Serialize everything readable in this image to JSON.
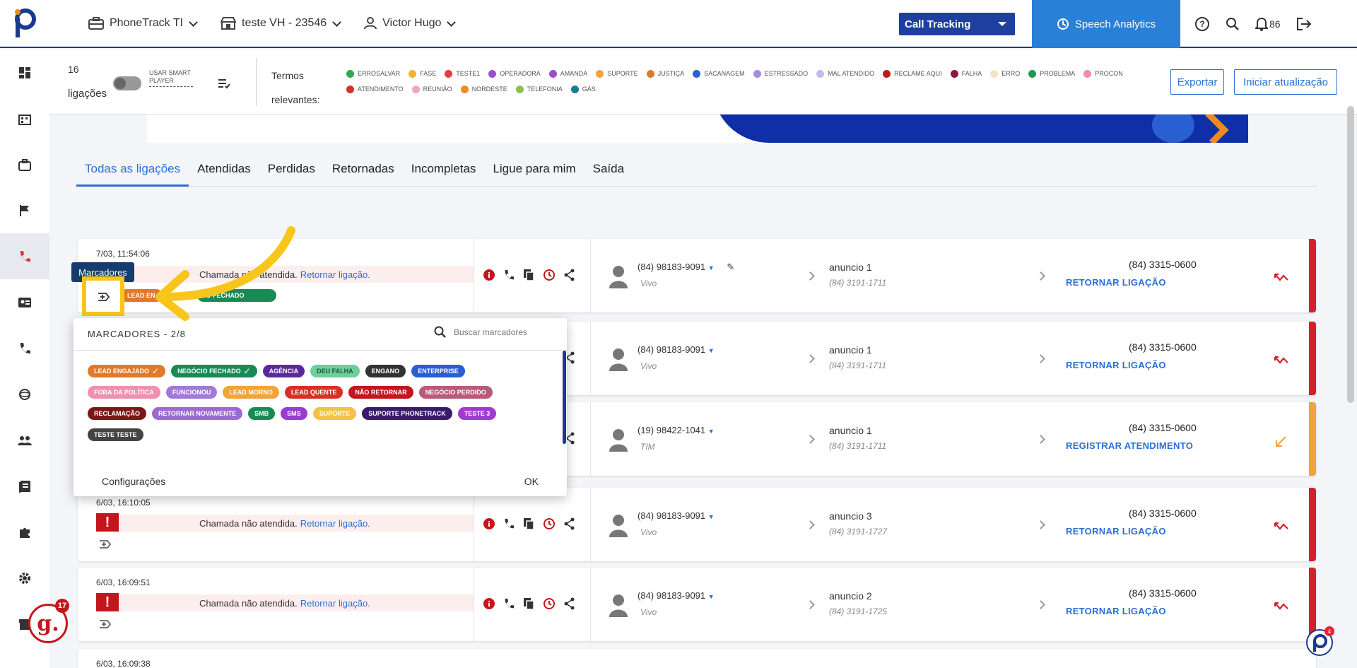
{
  "header": {
    "account": "PhoneTrack TI",
    "store": "teste VH - 23546",
    "user": "Victor Hugo",
    "product_select": "Call Tracking",
    "speech_label": "Speech Analytics",
    "notifications": "86"
  },
  "filters": {
    "count": "16",
    "count_label": "ligações",
    "smart_player": "USAR SMART PLAYER",
    "terms_label": "Termos relevantes:",
    "terms": [
      {
        "label": "ERROSALVAR",
        "color": "#2eaa55"
      },
      {
        "label": "FASE",
        "color": "#f2b233"
      },
      {
        "label": "TESTE1",
        "color": "#e04040"
      },
      {
        "label": "OPERADORA",
        "color": "#9a4fd1"
      },
      {
        "label": "AMANDA",
        "color": "#9a4fd1"
      },
      {
        "label": "SUPORTE",
        "color": "#f2a33a"
      },
      {
        "label": "JUSTIÇA",
        "color": "#e07a2a"
      },
      {
        "label": "SACANAGEM",
        "color": "#2a5fd1"
      },
      {
        "label": "ESTRESSADO",
        "color": "#a68be0"
      },
      {
        "label": "MAL ATENDIDO",
        "color": "#c9b8ee"
      },
      {
        "label": "RECLAME AQUI",
        "color": "#c4161c"
      },
      {
        "label": "FALHA",
        "color": "#8b1a3a"
      },
      {
        "label": "ERRO",
        "color": "#f3e3c8"
      },
      {
        "label": "PROBLEMA",
        "color": "#1a9a55"
      },
      {
        "label": "PROCON",
        "color": "#f08aa8"
      },
      {
        "label": "ATENDIMENTO",
        "color": "#d93025"
      },
      {
        "label": "REUNIÃO",
        "color": "#f5a3c0"
      },
      {
        "label": "NORDESTE",
        "color": "#f08a24"
      },
      {
        "label": "TELEFONIA",
        "color": "#8bc34a"
      },
      {
        "label": "GÁS",
        "color": "#1a7a9a"
      }
    ],
    "export_label": "Exportar",
    "refresh_label": "Iniciar atualização"
  },
  "tabs": [
    "Todas as ligações",
    "Atendidas",
    "Perdidas",
    "Retornadas",
    "Incompletas",
    "Ligue para mim",
    "Saída"
  ],
  "tooltip": "Marcadores",
  "card_tags": [
    {
      "label": "LEAD EN",
      "color": "#e07a2a"
    },
    {
      "label": "IO FECHADO",
      "color": "#1a8a55"
    }
  ],
  "calls": [
    {
      "date": "7/03, 11:54:06",
      "msg": "Chamada não atendida.",
      "link": "Retornar ligação.",
      "phone": "(84) 98183-9091",
      "carrier": "Vivo",
      "anuncio": "anuncio 1",
      "anuncio_phone": "(84) 3191-1711",
      "dest": "(84) 3315-0600",
      "action": "RETORNAR LIGAÇÃO",
      "status_color": "#d4202a"
    },
    {
      "date": "",
      "msg": "",
      "link": "",
      "phone": "(84) 98183-9091",
      "carrier": "Vivo",
      "anuncio": "anuncio 1",
      "anuncio_phone": "(84) 3191-1711",
      "dest": "(84) 3315-0600",
      "action": "RETORNAR LIGAÇÃO",
      "status_color": "#d4202a"
    },
    {
      "date": "",
      "msg": "",
      "link": "",
      "phone": "(19) 98422-1041",
      "carrier": "TIM",
      "anuncio": "anuncio 1",
      "anuncio_phone": "(84) 3191-1711",
      "dest": "(84) 3315-0600",
      "action": "REGISTRAR ATENDIMENTO",
      "status_color": "#f2a33a"
    },
    {
      "date": "6/03, 16:10:05",
      "msg": "Chamada não atendida.",
      "link": "Retornar ligação.",
      "phone": "(84) 98183-9091",
      "carrier": "Vivo",
      "anuncio": "anuncio 3",
      "anuncio_phone": "(84) 3191-1727",
      "dest": "(84) 3315-0600",
      "action": "RETORNAR LIGAÇÃO",
      "status_color": "#d4202a"
    },
    {
      "date": "6/03, 16:09:51",
      "msg": "Chamada não atendida.",
      "link": "Retornar ligação.",
      "phone": "(84) 98183-9091",
      "carrier": "Vivo",
      "anuncio": "anuncio 2",
      "anuncio_phone": "(84) 3191-1725",
      "dest": "(84) 3315-0600",
      "action": "RETORNAR LIGAÇÃO",
      "status_color": "#d4202a"
    },
    {
      "date": "6/03, 16:09:38"
    }
  ],
  "popup": {
    "title": "MARCADORES - 2/8",
    "search_placeholder": "Buscar marcadores",
    "tags": [
      {
        "label": "LEAD ENGAJADO",
        "color": "#e07a2a",
        "checked": true
      },
      {
        "label": "NEGÓCIO FECHADO",
        "color": "#1a8a55",
        "checked": true
      },
      {
        "label": "AGÊNCIA",
        "color": "#5b2a9a",
        "checked": false
      },
      {
        "label": "DEU FALHA",
        "color": "#6ecf9a",
        "checked": false
      },
      {
        "label": "ENGANO",
        "color": "#333333",
        "checked": false
      },
      {
        "label": "ENTERPRISE",
        "color": "#2a5fd1",
        "checked": false
      },
      {
        "label": "FORA DA POLÍTICA",
        "color": "#f090b0",
        "checked": false
      },
      {
        "label": "FUNCIONOU",
        "color": "#a07ad8",
        "checked": false
      },
      {
        "label": "LEAD MORNO",
        "color": "#f2a33a",
        "checked": false
      },
      {
        "label": "LEAD QUENTE",
        "color": "#d93025",
        "checked": false
      },
      {
        "label": "NÃO RETORNAR",
        "color": "#c4161c",
        "checked": false
      },
      {
        "label": "NEGÓCIO PERDIDO",
        "color": "#b85a7a",
        "checked": false
      },
      {
        "label": "RECLAMAÇÃO",
        "color": "#7a1818",
        "checked": false
      },
      {
        "label": "RETORNAR NOVAMENTE",
        "color": "#9a6ad1",
        "checked": false
      },
      {
        "label": "SMB",
        "color": "#1a8a55",
        "checked": false
      },
      {
        "label": "SMS",
        "color": "#9a3ad1",
        "checked": false
      },
      {
        "label": "SUPORTE",
        "color": "#f2c24a",
        "checked": false
      },
      {
        "label": "SUPORTE PHONETRACK",
        "color": "#3a1a6a",
        "checked": false
      },
      {
        "label": "TESTE 3",
        "color": "#a03ad1",
        "checked": false
      },
      {
        "label": "TESTE TESTE",
        "color": "#444444",
        "checked": false
      }
    ],
    "settings_label": "Configurações",
    "ok_label": "OK"
  },
  "badges": {
    "g_count": "17",
    "g_letter": "g.",
    "p_count": "4"
  }
}
